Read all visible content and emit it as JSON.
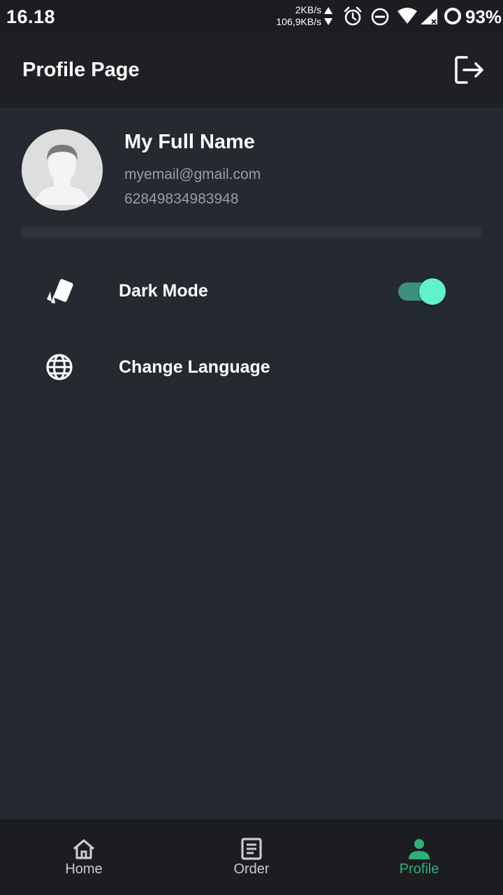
{
  "status_bar": {
    "time": "16.18",
    "upload_speed": "2KB/s",
    "download_speed": "106,9KB/s",
    "battery": "93%",
    "icons": [
      "alarm-icon",
      "do-not-disturb-icon",
      "wifi-icon",
      "cellular-signal-icon",
      "battery-icon"
    ]
  },
  "app_bar": {
    "title": "Profile Page",
    "logout_icon": "logout-icon"
  },
  "profile": {
    "name": "My Full Name",
    "email": "myemail@gmail.com",
    "phone": "62849834983948"
  },
  "menu": {
    "items": [
      {
        "label": "Dark Mode",
        "icon": "theme-cards-icon",
        "toggle_on": true
      },
      {
        "label": "Change Language",
        "icon": "globe-icon"
      }
    ]
  },
  "bottom_nav": {
    "items": [
      {
        "label": "Home",
        "icon": "home-icon",
        "active": false
      },
      {
        "label": "Order",
        "icon": "order-list-icon",
        "active": false
      },
      {
        "label": "Profile",
        "icon": "person-icon",
        "active": true
      }
    ],
    "active_color": "#2fb07a",
    "inactive_color": "#c9cbcf"
  },
  "colors": {
    "background": "#252930",
    "app_bar": "#1e2024",
    "toggle_track": "#3e8f7d",
    "toggle_thumb": "#5ff2cc"
  }
}
